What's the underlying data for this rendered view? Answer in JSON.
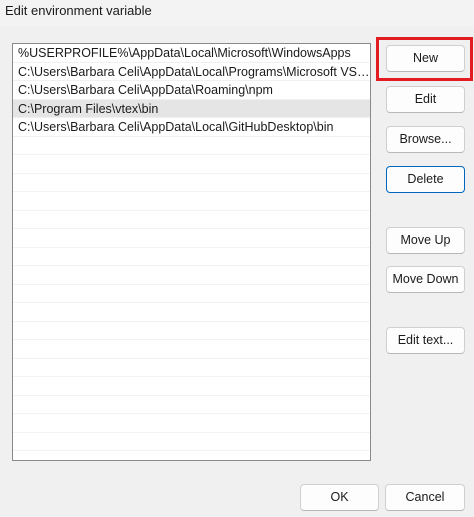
{
  "window": {
    "title": "Edit environment variable"
  },
  "list": {
    "items": [
      "%USERPROFILE%\\AppData\\Local\\Microsoft\\WindowsApps",
      "C:\\Users\\Barbara Celi\\AppData\\Local\\Programs\\Microsoft VS Code...",
      "C:\\Users\\Barbara Celi\\AppData\\Roaming\\npm",
      "C:\\Program Files\\vtex\\bin",
      "C:\\Users\\Barbara Celi\\AppData\\Local\\GitHubDesktop\\bin"
    ],
    "selected_index": 3
  },
  "buttons": {
    "new": "New",
    "edit": "Edit",
    "browse": "Browse...",
    "delete": "Delete",
    "move_up": "Move Up",
    "move_down": "Move Down",
    "edit_text": "Edit text...",
    "ok": "OK",
    "cancel": "Cancel"
  },
  "colors": {
    "highlight": "#e31b23",
    "accent": "#0067c0",
    "selection": "#e5e5e5"
  }
}
